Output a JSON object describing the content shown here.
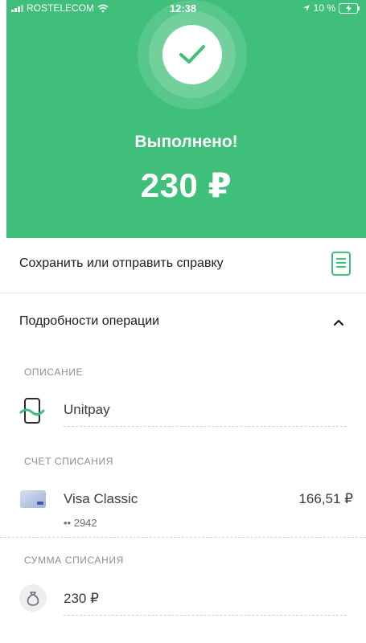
{
  "status_bar": {
    "carrier": "ROSTELECOM",
    "time": "12:38",
    "battery": "10 %"
  },
  "header": {
    "title": "Выполнено!",
    "amount": "230 ₽",
    "bg_color": "#3fbf7a"
  },
  "actions": {
    "save_label": "Сохранить или отправить справку"
  },
  "details": {
    "toggle_label": "Подробности операции",
    "description": {
      "label": "ОПИСАНИЕ",
      "value": "Unitpay"
    },
    "account": {
      "label": "СЧЕТ СПИСАНИЯ",
      "card_name": "Visa Classic",
      "card_number": "•• 2942",
      "balance": "166,51 ₽"
    },
    "sum": {
      "label": "СУММА СПИСАНИЯ",
      "value": "230 ₽"
    }
  }
}
